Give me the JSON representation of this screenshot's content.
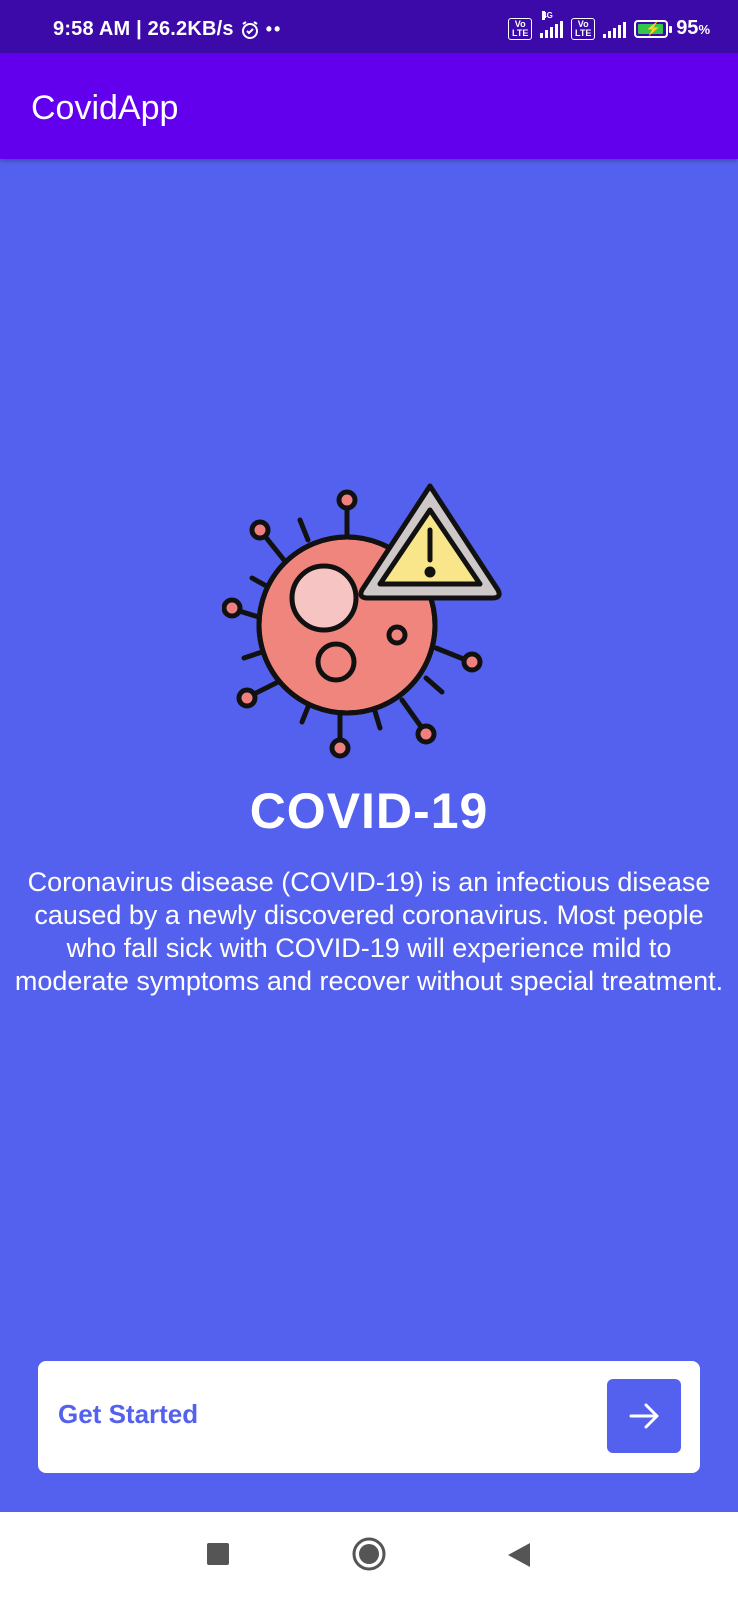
{
  "status_bar": {
    "time_speed": "9:58 AM | 26.2KB/s",
    "dots": "••",
    "volte1": "Vo LTE",
    "net_tag": "4G",
    "volte2": "Vo LTE",
    "battery_pct": "95",
    "battery_unit": "%",
    "battery_level": 0.95,
    "charging": true
  },
  "app_bar": {
    "title": "CovidApp"
  },
  "hero": {
    "illustration": "virus-warning-icon",
    "title": "COVID-19",
    "description": "Coronavirus disease (COVID-19) is an infectious disease caused by a newly discovered coronavirus. Most people who fall sick with COVID-19 will experience mild to moderate symptoms and recover without special treatment."
  },
  "cta": {
    "label": "Get Started",
    "icon": "arrow-right-icon"
  },
  "colors": {
    "background": "#5461EE",
    "app_bar": "#6200EE",
    "status_bar": "#3C0AA8",
    "accent": "#5461EE"
  },
  "nav": {
    "recent_icon": "square-icon",
    "home_icon": "circle-icon",
    "back_icon": "triangle-back-icon"
  }
}
